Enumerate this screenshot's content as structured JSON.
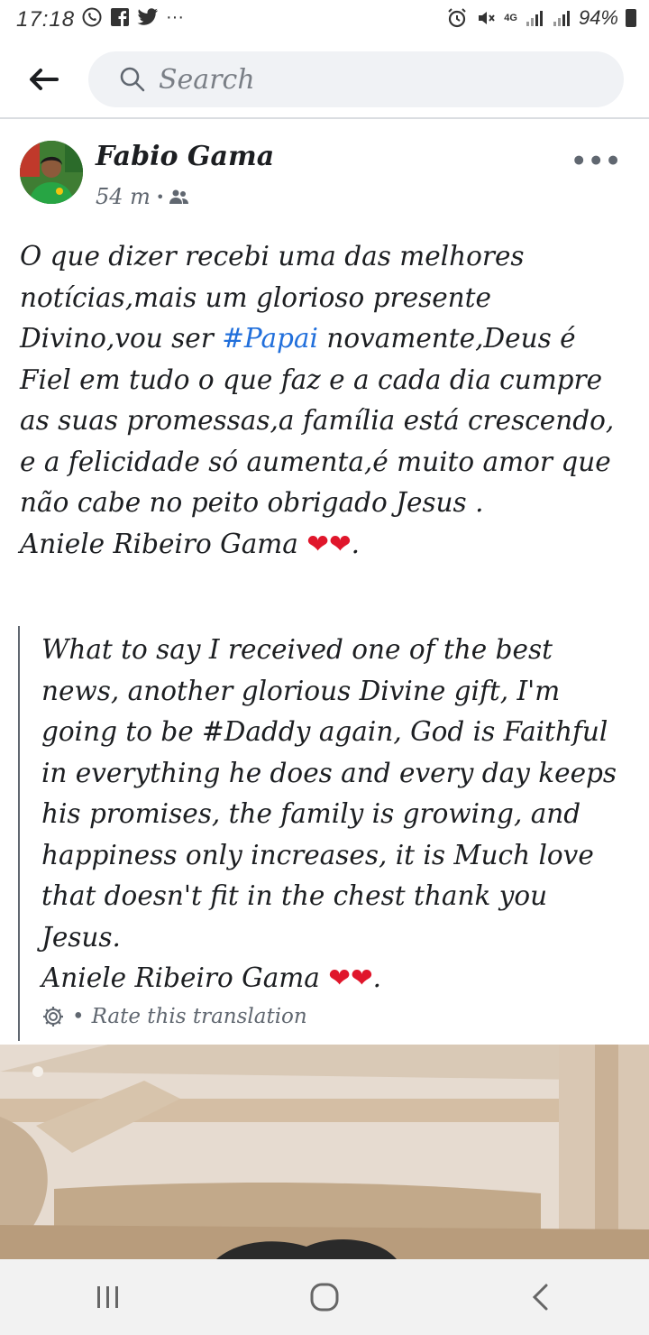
{
  "status_bar": {
    "time": "17:18",
    "battery": "94%",
    "network": "4G",
    "left_icons": [
      "whatsapp-icon",
      "facebook-icon",
      "twitter-icon",
      "more-notifications-icon"
    ],
    "right_icons": [
      "alarm-icon",
      "mute-icon",
      "signal-icon",
      "signal-icon",
      "battery-icon"
    ]
  },
  "search": {
    "placeholder": "Search"
  },
  "post": {
    "author": "Fabio Gama",
    "time": "54 m",
    "audience_icon": "friends-icon",
    "text_before_tag": "O que dizer recebi uma das melhores notícias,mais um glorioso presente Divino,vou ser ",
    "hashtag": "#Papai",
    "text_after_tag": " novamente,Deus é Fiel em tudo o que faz e a cada dia cumpre as suas promessas,a família está crescendo, e a felicidade só aumenta,é muito amor que não cabe no peito obrigado Jesus .\nAniele Ribeiro Gama ",
    "hearts": "❤❤",
    "end_punct": "."
  },
  "translation": {
    "text": "What to say I received one of the best news, another glorious Divine gift, I'm going to be #Daddy again, God is Faithful in everything he does and every day keeps his promises, the family is growing, and happiness only increases, it is Much love that doesn't fit in the chest thank you Jesus.\nAniele Ribeiro Gama ",
    "hearts": "❤❤",
    "end_punct": ".",
    "separator": "•",
    "rate_label": "Rate this translation"
  },
  "nav": {
    "buttons": [
      "recent-apps-icon",
      "home-icon",
      "back-icon"
    ]
  },
  "colors": {
    "hashtag": "#216fdb",
    "heart": "#e0162b",
    "search_bg": "#f0f2f5"
  }
}
